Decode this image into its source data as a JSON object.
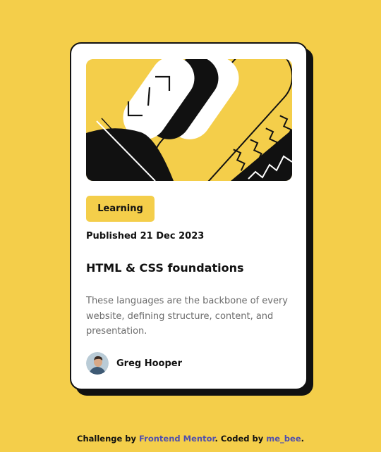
{
  "card": {
    "tag": "Learning",
    "published": "Published 21 Dec 2023",
    "title": "HTML & CSS foundations",
    "description": "These languages are the backbone of every website, defining structure, content, and presentation.",
    "author_name": "Greg Hooper"
  },
  "footer": {
    "prefix": "Challenge by",
    "challenge_link": "Frontend Mentor",
    "middle": ". Coded by",
    "coder_link": "me_bee",
    "suffix": "."
  },
  "colors": {
    "background": "#F4CE4A",
    "card": "#FFFFFF",
    "ink": "#111111",
    "muted_text": "#6B6B6B",
    "link": "#4F4FAE"
  }
}
